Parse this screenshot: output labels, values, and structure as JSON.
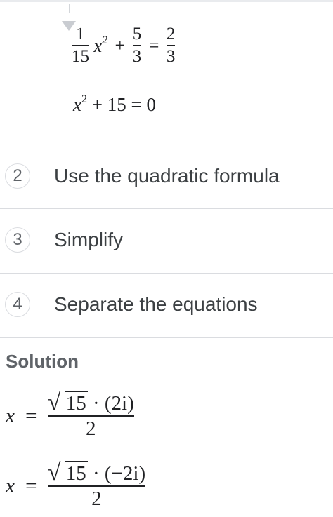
{
  "equations": {
    "eq1": {
      "num1": "1",
      "den1": "15",
      "var": "x",
      "exp": "2",
      "plus": "+",
      "num2": "5",
      "den2": "3",
      "equals": "=",
      "num3": "2",
      "den3": "3"
    },
    "eq2": {
      "var": "x",
      "exp": "2",
      "rest": "+ 15 = 0"
    }
  },
  "steps": [
    {
      "number": "2",
      "label": "Use the quadratic formula"
    },
    {
      "number": "3",
      "label": "Simplify"
    },
    {
      "number": "4",
      "label": "Separate the equations"
    }
  ],
  "solution": {
    "heading": "Solution",
    "items": [
      {
        "var": "x",
        "equals": "=",
        "radicand": "15",
        "factor": "· (2i)",
        "den": "2"
      },
      {
        "var": "x",
        "equals": "=",
        "radicand": "15",
        "factor": "· (−2i)",
        "den": "2"
      }
    ]
  }
}
